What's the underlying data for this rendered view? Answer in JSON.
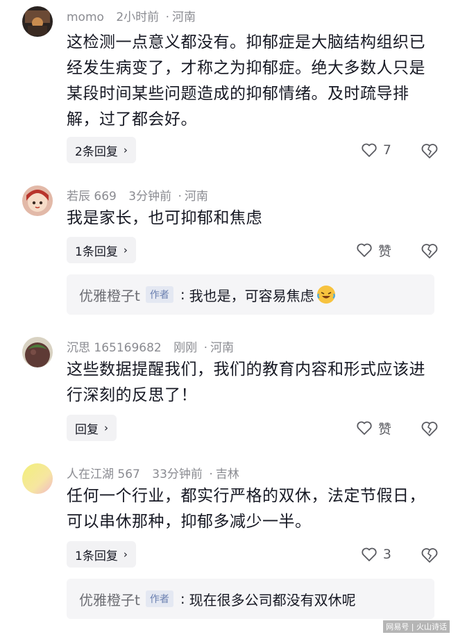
{
  "comments": [
    {
      "username": "momo",
      "time": "2小时前",
      "location": "河南",
      "text": "这检测一点意义都没有。抑郁症是大脑结构组织已经发生病变了，才称之为抑郁症。绝大多数人只是某段时间某些问题造成的抑郁情绪。及时疏导排解，过了都会好。",
      "reply_label": "2条回复",
      "likes": "7"
    },
    {
      "username": "若辰 669",
      "time": "3分钟前",
      "location": "河南",
      "text": "我是家长，也可抑郁和焦虑",
      "reply_label": "1条回复",
      "likes": "赞",
      "subreply": {
        "name": "优雅橙子t",
        "tag": "作者",
        "text": "我也是，可容易焦虑"
      }
    },
    {
      "username": "沉思 165169682",
      "time": "刚刚",
      "location": "河南",
      "text": "这些数据提醒我们，我们的教育内容和形式应该进行深刻的反思了！",
      "reply_label": "回复",
      "likes": "赞"
    },
    {
      "username": "人在江湖 567",
      "time": "33分钟前",
      "location": "吉林",
      "text": "任何一个行业，都实行严格的双休，法定节假日，可以串休那种，抑郁多减少一半。",
      "reply_label": "1条回复",
      "likes": "3",
      "subreply": {
        "name": "优雅橙子t",
        "tag": "作者",
        "text": "现在很多公司都没有双休呢"
      }
    }
  ],
  "meta_separator": "·",
  "watermark": "网易号 | 火山诗话"
}
